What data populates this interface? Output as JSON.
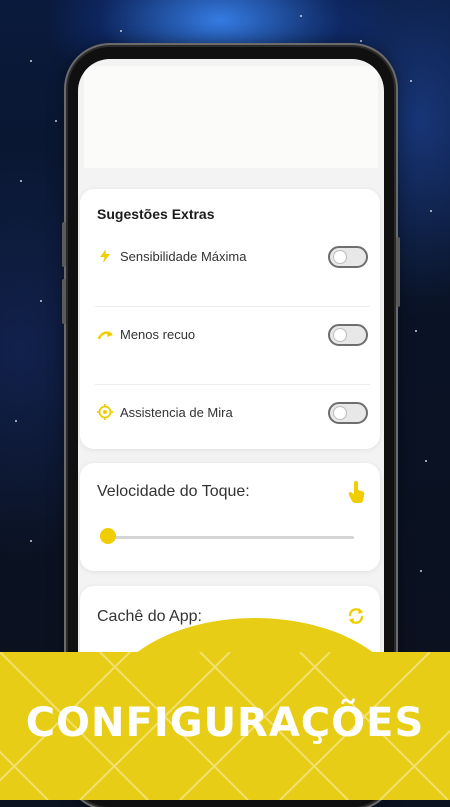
{
  "extras": {
    "title": "Sugestões Extras",
    "items": [
      {
        "label": "Sensibilidade Máxima",
        "icon": "lightning-icon",
        "enabled": false
      },
      {
        "label": "Menos recuo",
        "icon": "curved-arrow-icon",
        "enabled": false
      },
      {
        "label": "Assistencia de Mira",
        "icon": "crosshair-icon",
        "enabled": false
      }
    ]
  },
  "speed": {
    "title": "Velocidade do Toque:",
    "icon": "pointing-hand-icon",
    "value": 0.0
  },
  "cache": {
    "title": "Cachê do App:",
    "icon": "refresh-icon"
  },
  "banner": {
    "text": "CONFIGURAÇÕES"
  },
  "colors": {
    "accent": "#f0cd00",
    "banner": "#e8cd16"
  }
}
